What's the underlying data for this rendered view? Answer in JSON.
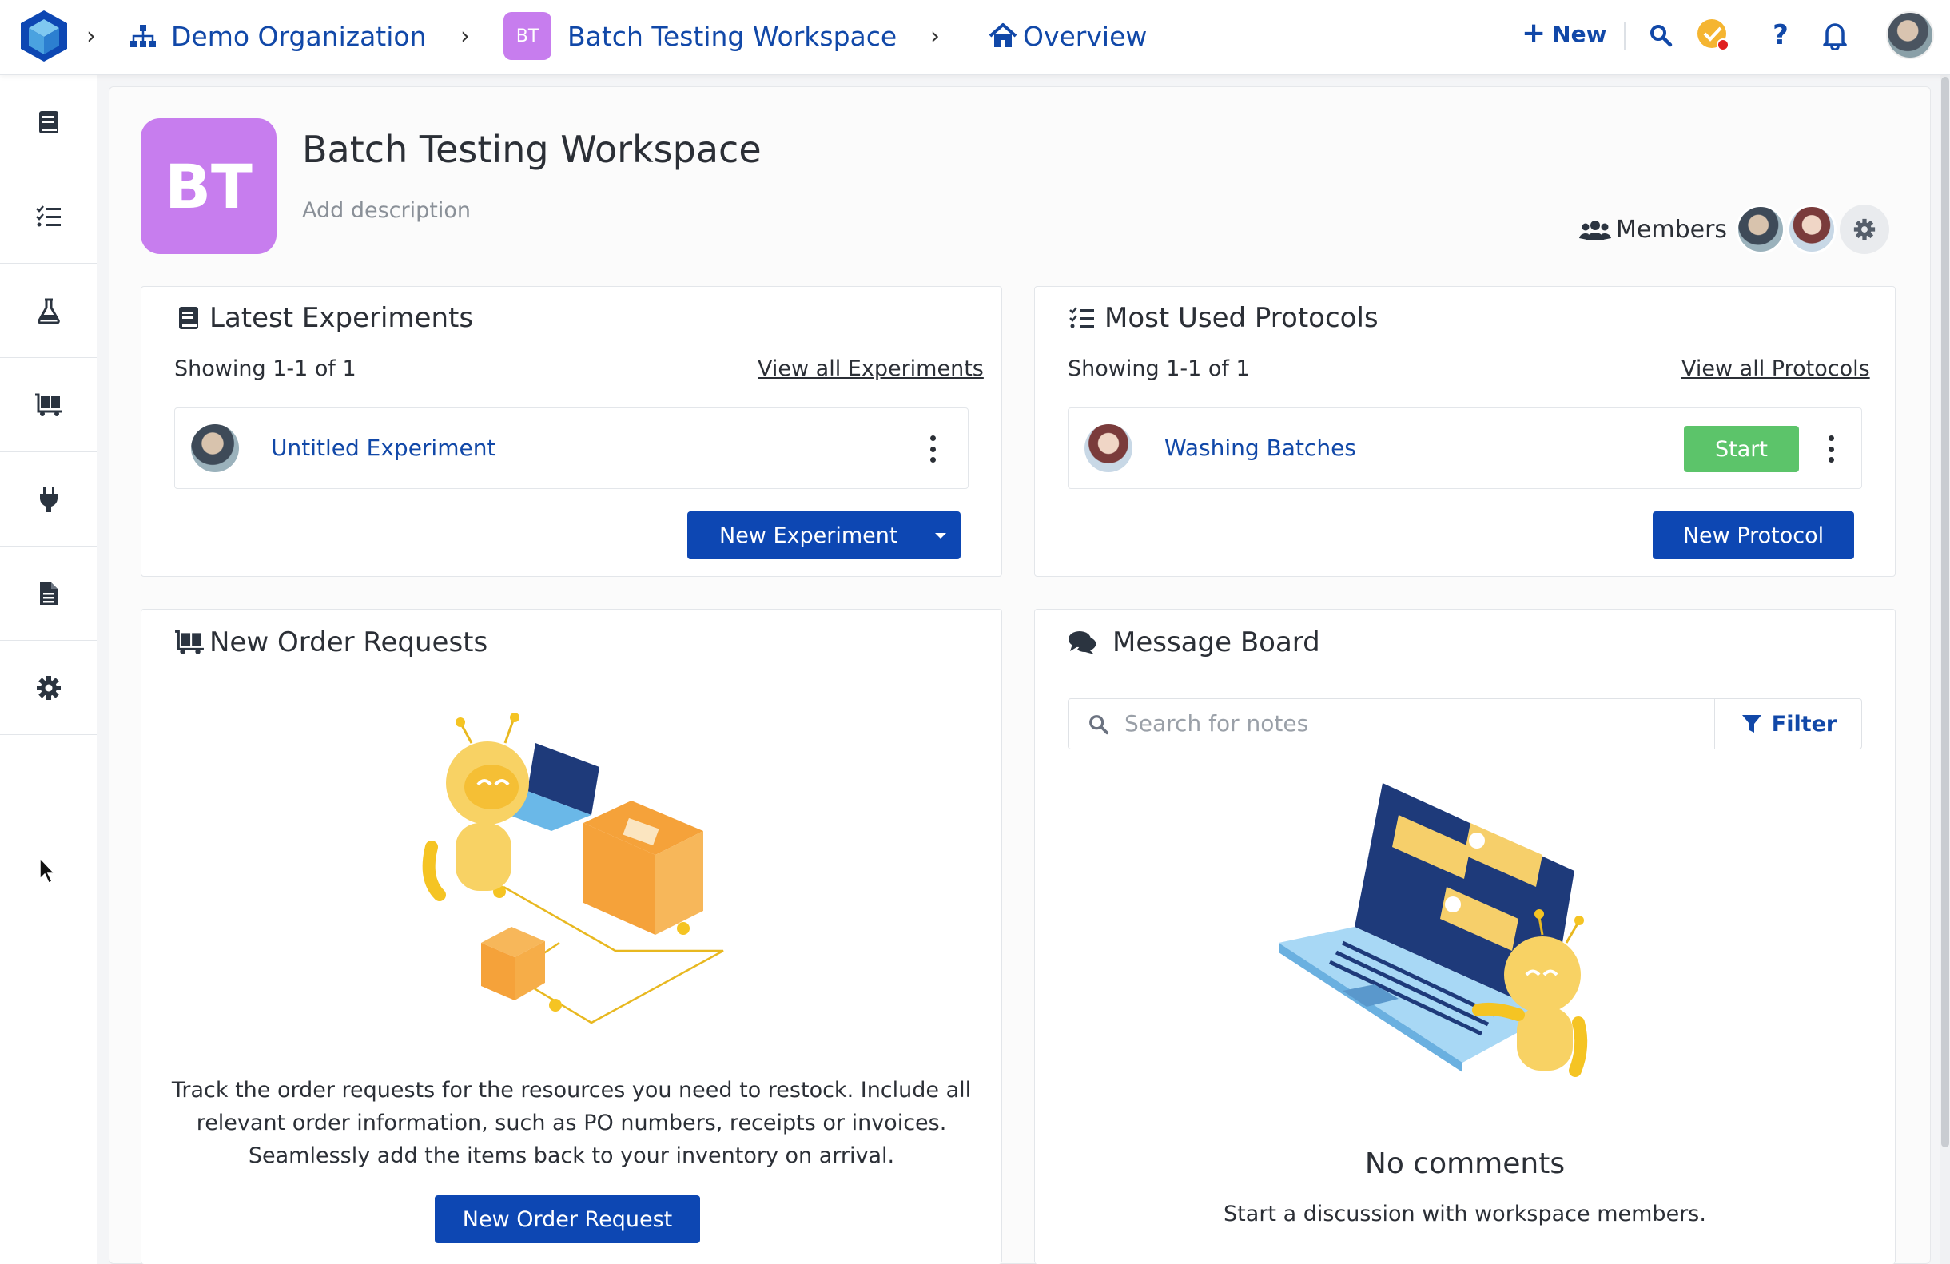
{
  "topbar": {
    "org_name": "Demo Organization",
    "workspace_badge": "BT",
    "workspace_name": "Batch Testing Workspace",
    "page_name": "Overview",
    "new_label": "New"
  },
  "workspace": {
    "badge": "BT",
    "title": "Batch Testing Workspace",
    "description_placeholder": "Add description",
    "members_label": "Members"
  },
  "experiments": {
    "title": "Latest Experiments",
    "showing": "Showing 1-1 of 1",
    "view_all": "View all Experiments",
    "items": [
      {
        "name": "Untitled Experiment"
      }
    ],
    "new_button": "New Experiment"
  },
  "protocols": {
    "title": "Most Used Protocols",
    "showing": "Showing 1-1 of 1",
    "view_all": "View all Protocols",
    "items": [
      {
        "name": "Washing Batches",
        "action": "Start"
      }
    ],
    "new_button": "New Protocol"
  },
  "orders": {
    "title": "New Order Requests",
    "description_lines": [
      "Track the order requests for the resources you need to restock. Include all",
      "relevant order information, such as PO numbers, receipts or invoices.",
      "Seamlessly add the items back to your inventory on arrival."
    ],
    "new_button": "New Order Request"
  },
  "messages": {
    "title": "Message Board",
    "search_placeholder": "Search for notes",
    "filter_label": "Filter",
    "empty_title": "No comments",
    "empty_subtitle": "Start a discussion with workspace members."
  },
  "colors": {
    "primary": "#0d47b3",
    "link": "#1148a8",
    "workspace_badge": "#c77dee",
    "start_green": "#5cc46a"
  }
}
